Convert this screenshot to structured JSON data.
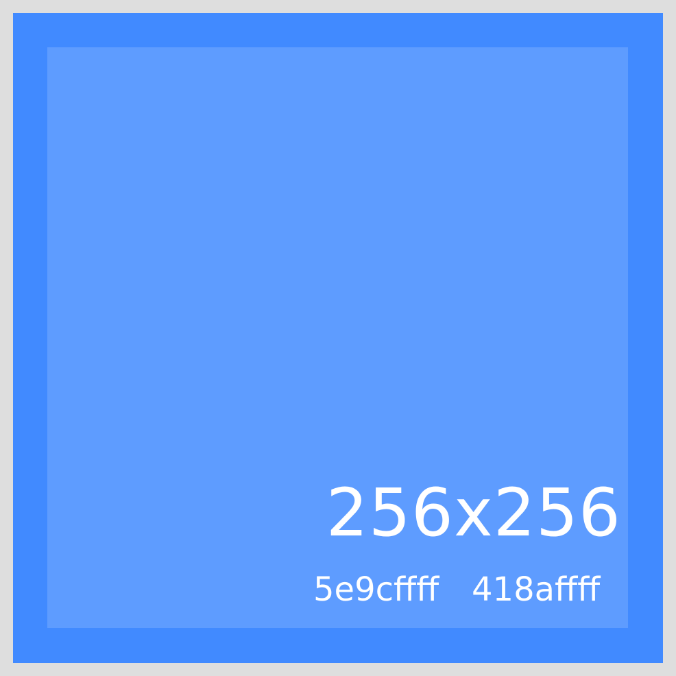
{
  "placeholder": {
    "size_text": "256x256",
    "inner_color_code": "5e9cffff",
    "outer_color_code": "418affff",
    "colors": {
      "border": "#dedede",
      "outer": "#418aff",
      "inner": "#5e9cff",
      "text": "#ffffff"
    }
  }
}
